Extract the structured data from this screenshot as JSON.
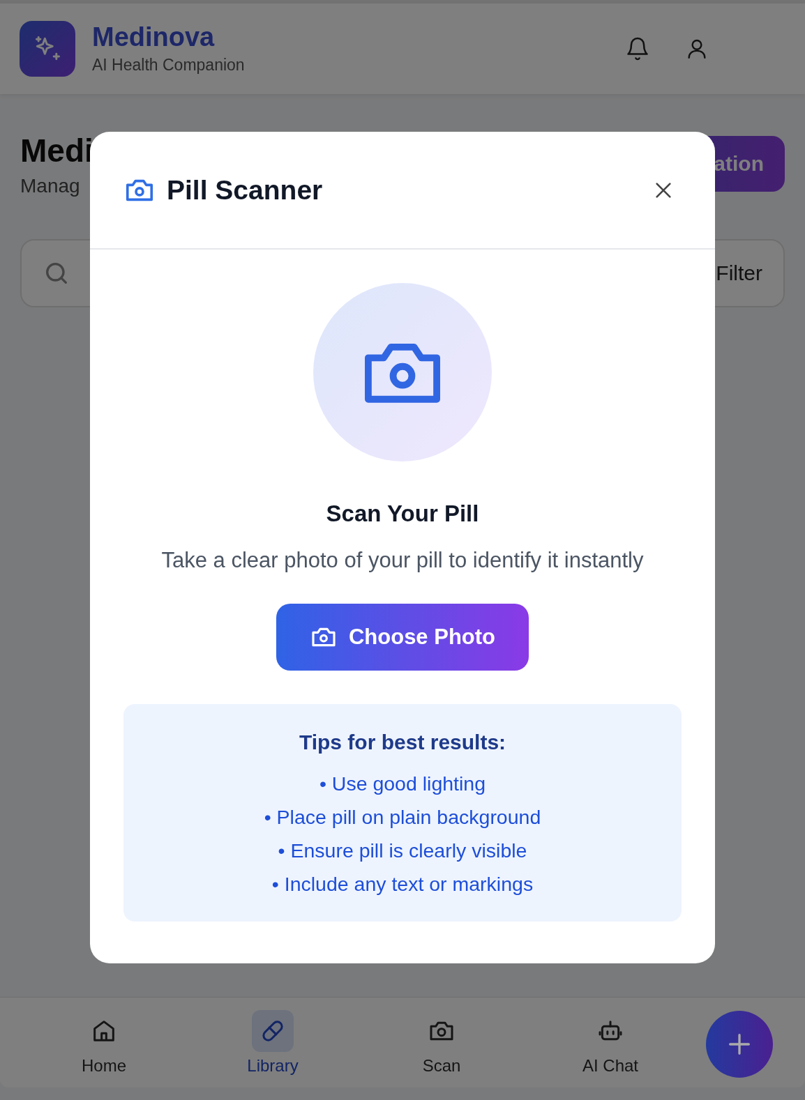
{
  "header": {
    "app_name": "Medinova",
    "tagline": "AI Health Companion"
  },
  "page": {
    "title": "Medi",
    "subtitle": "Manag",
    "primary_button": "ation",
    "filter_button": "Filter"
  },
  "modal": {
    "title": "Pill Scanner",
    "heading": "Scan Your Pill",
    "description": "Take a clear photo of your pill to identify it instantly",
    "button": "Choose Photo",
    "tips": {
      "title": "Tips for best results:",
      "items": [
        "• Use good lighting",
        "• Place pill on plain background",
        "• Ensure pill is clearly visible",
        "• Include any text or markings"
      ]
    }
  },
  "nav": {
    "items": [
      {
        "label": "Home",
        "kind": "home",
        "selected": false
      },
      {
        "label": "Library",
        "kind": "pill",
        "selected": true
      },
      {
        "label": "Scan",
        "kind": "camera",
        "selected": false
      },
      {
        "label": "AI Chat",
        "kind": "bot",
        "selected": false
      }
    ]
  }
}
